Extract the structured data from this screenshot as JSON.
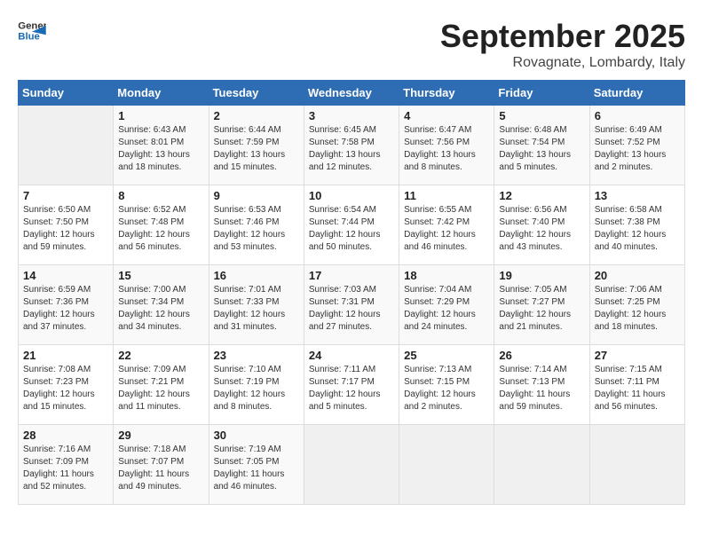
{
  "header": {
    "logo_general": "General",
    "logo_blue": "Blue",
    "month_year": "September 2025",
    "location": "Rovagnate, Lombardy, Italy"
  },
  "days_of_week": [
    "Sunday",
    "Monday",
    "Tuesday",
    "Wednesday",
    "Thursday",
    "Friday",
    "Saturday"
  ],
  "weeks": [
    [
      {
        "day": "",
        "details": ""
      },
      {
        "day": "1",
        "details": "Sunrise: 6:43 AM\nSunset: 8:01 PM\nDaylight: 13 hours\nand 18 minutes."
      },
      {
        "day": "2",
        "details": "Sunrise: 6:44 AM\nSunset: 7:59 PM\nDaylight: 13 hours\nand 15 minutes."
      },
      {
        "day": "3",
        "details": "Sunrise: 6:45 AM\nSunset: 7:58 PM\nDaylight: 13 hours\nand 12 minutes."
      },
      {
        "day": "4",
        "details": "Sunrise: 6:47 AM\nSunset: 7:56 PM\nDaylight: 13 hours\nand 8 minutes."
      },
      {
        "day": "5",
        "details": "Sunrise: 6:48 AM\nSunset: 7:54 PM\nDaylight: 13 hours\nand 5 minutes."
      },
      {
        "day": "6",
        "details": "Sunrise: 6:49 AM\nSunset: 7:52 PM\nDaylight: 13 hours\nand 2 minutes."
      }
    ],
    [
      {
        "day": "7",
        "details": "Sunrise: 6:50 AM\nSunset: 7:50 PM\nDaylight: 12 hours\nand 59 minutes."
      },
      {
        "day": "8",
        "details": "Sunrise: 6:52 AM\nSunset: 7:48 PM\nDaylight: 12 hours\nand 56 minutes."
      },
      {
        "day": "9",
        "details": "Sunrise: 6:53 AM\nSunset: 7:46 PM\nDaylight: 12 hours\nand 53 minutes."
      },
      {
        "day": "10",
        "details": "Sunrise: 6:54 AM\nSunset: 7:44 PM\nDaylight: 12 hours\nand 50 minutes."
      },
      {
        "day": "11",
        "details": "Sunrise: 6:55 AM\nSunset: 7:42 PM\nDaylight: 12 hours\nand 46 minutes."
      },
      {
        "day": "12",
        "details": "Sunrise: 6:56 AM\nSunset: 7:40 PM\nDaylight: 12 hours\nand 43 minutes."
      },
      {
        "day": "13",
        "details": "Sunrise: 6:58 AM\nSunset: 7:38 PM\nDaylight: 12 hours\nand 40 minutes."
      }
    ],
    [
      {
        "day": "14",
        "details": "Sunrise: 6:59 AM\nSunset: 7:36 PM\nDaylight: 12 hours\nand 37 minutes."
      },
      {
        "day": "15",
        "details": "Sunrise: 7:00 AM\nSunset: 7:34 PM\nDaylight: 12 hours\nand 34 minutes."
      },
      {
        "day": "16",
        "details": "Sunrise: 7:01 AM\nSunset: 7:33 PM\nDaylight: 12 hours\nand 31 minutes."
      },
      {
        "day": "17",
        "details": "Sunrise: 7:03 AM\nSunset: 7:31 PM\nDaylight: 12 hours\nand 27 minutes."
      },
      {
        "day": "18",
        "details": "Sunrise: 7:04 AM\nSunset: 7:29 PM\nDaylight: 12 hours\nand 24 minutes."
      },
      {
        "day": "19",
        "details": "Sunrise: 7:05 AM\nSunset: 7:27 PM\nDaylight: 12 hours\nand 21 minutes."
      },
      {
        "day": "20",
        "details": "Sunrise: 7:06 AM\nSunset: 7:25 PM\nDaylight: 12 hours\nand 18 minutes."
      }
    ],
    [
      {
        "day": "21",
        "details": "Sunrise: 7:08 AM\nSunset: 7:23 PM\nDaylight: 12 hours\nand 15 minutes."
      },
      {
        "day": "22",
        "details": "Sunrise: 7:09 AM\nSunset: 7:21 PM\nDaylight: 12 hours\nand 11 minutes."
      },
      {
        "day": "23",
        "details": "Sunrise: 7:10 AM\nSunset: 7:19 PM\nDaylight: 12 hours\nand 8 minutes."
      },
      {
        "day": "24",
        "details": "Sunrise: 7:11 AM\nSunset: 7:17 PM\nDaylight: 12 hours\nand 5 minutes."
      },
      {
        "day": "25",
        "details": "Sunrise: 7:13 AM\nSunset: 7:15 PM\nDaylight: 12 hours\nand 2 minutes."
      },
      {
        "day": "26",
        "details": "Sunrise: 7:14 AM\nSunset: 7:13 PM\nDaylight: 11 hours\nand 59 minutes."
      },
      {
        "day": "27",
        "details": "Sunrise: 7:15 AM\nSunset: 7:11 PM\nDaylight: 11 hours\nand 56 minutes."
      }
    ],
    [
      {
        "day": "28",
        "details": "Sunrise: 7:16 AM\nSunset: 7:09 PM\nDaylight: 11 hours\nand 52 minutes."
      },
      {
        "day": "29",
        "details": "Sunrise: 7:18 AM\nSunset: 7:07 PM\nDaylight: 11 hours\nand 49 minutes."
      },
      {
        "day": "30",
        "details": "Sunrise: 7:19 AM\nSunset: 7:05 PM\nDaylight: 11 hours\nand 46 minutes."
      },
      {
        "day": "",
        "details": ""
      },
      {
        "day": "",
        "details": ""
      },
      {
        "day": "",
        "details": ""
      },
      {
        "day": "",
        "details": ""
      }
    ]
  ]
}
